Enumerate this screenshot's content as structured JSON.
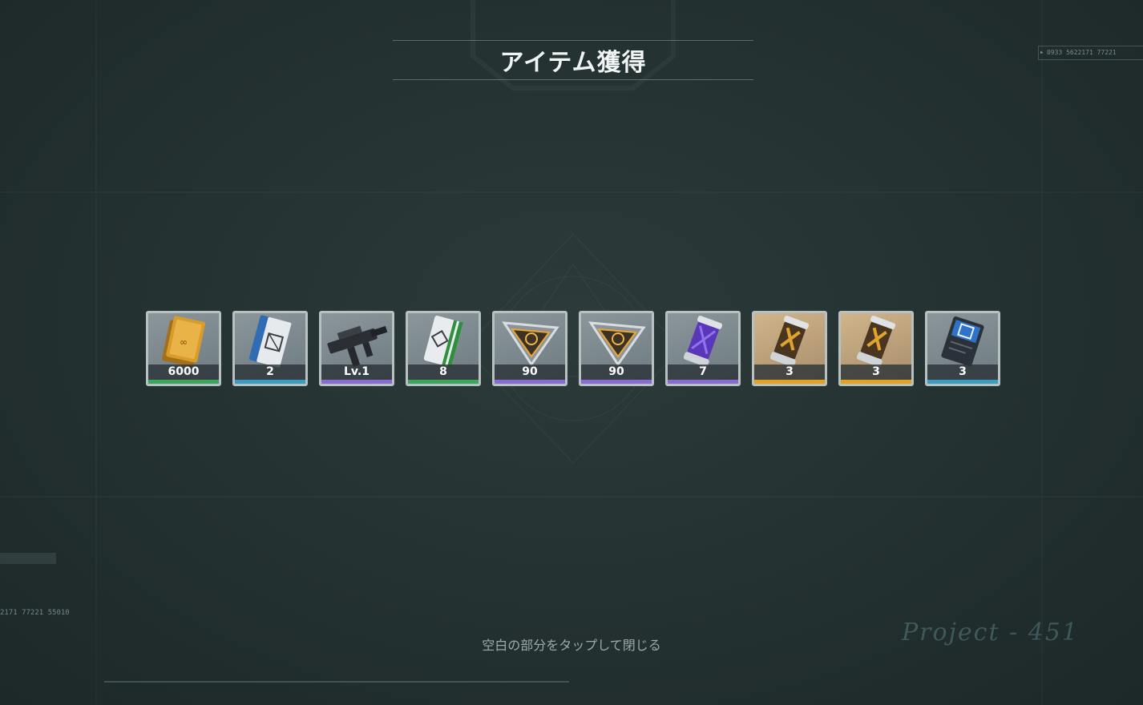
{
  "header": {
    "title": "アイテム獲得"
  },
  "serial_text": "0933  5622171  77221",
  "left_code_text": "2171  77221  55010",
  "items": [
    {
      "name": "gold-ingot",
      "quantity": "6000",
      "rarity_color": "#3da55d"
    },
    {
      "name": "blue-ticket",
      "quantity": "2",
      "rarity_color": "#3d9bc2"
    },
    {
      "name": "submachine-gun",
      "quantity": "Lv.1",
      "rarity_color": "#8a6bd1"
    },
    {
      "name": "green-ticket",
      "quantity": "8",
      "rarity_color": "#3da55d"
    },
    {
      "name": "core-badge",
      "quantity": "90",
      "rarity_color": "#8a6bd1"
    },
    {
      "name": "core-badge",
      "quantity": "90",
      "rarity_color": "#8a6bd1"
    },
    {
      "name": "purple-capsule",
      "quantity": "7",
      "rarity_color": "#8a6bd1"
    },
    {
      "name": "gold-capsule",
      "quantity": "3",
      "rarity_color": "#e5a21e"
    },
    {
      "name": "gold-capsule",
      "quantity": "3",
      "rarity_color": "#e5a21e"
    },
    {
      "name": "blue-card",
      "quantity": "3",
      "rarity_color": "#3d9bc2"
    }
  ],
  "footer": {
    "hint": "空白の部分をタップして閉じる"
  },
  "watermark_text": "Project - 451"
}
